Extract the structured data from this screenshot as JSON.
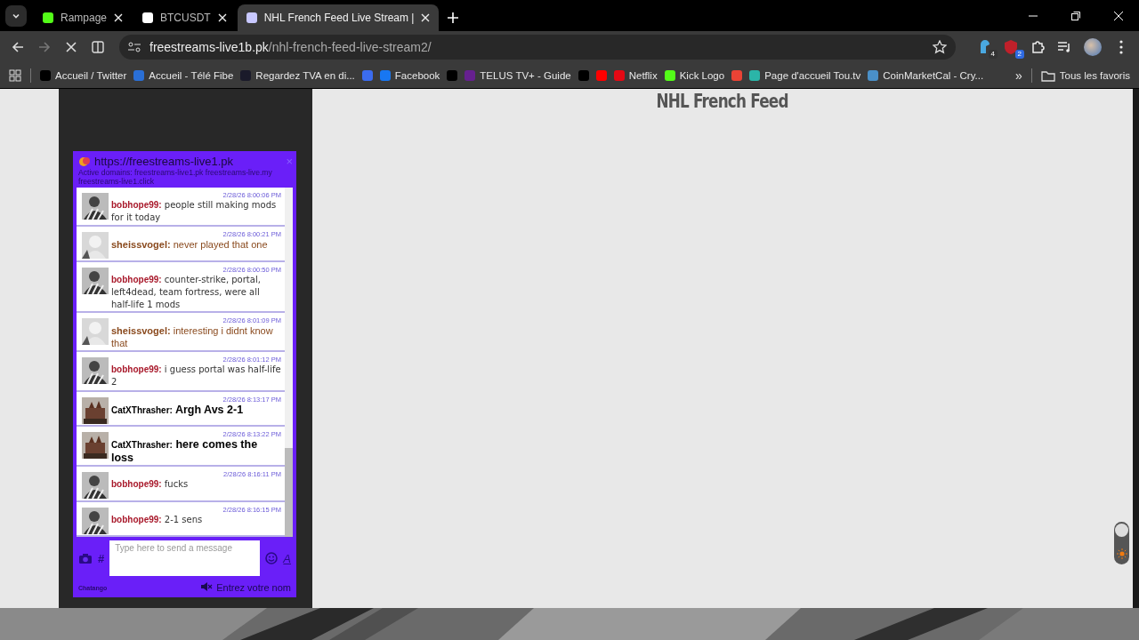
{
  "tabs": [
    {
      "title": "Rampage",
      "selected": false,
      "color": "#53fc18"
    },
    {
      "title": "BTCUSDT",
      "selected": false,
      "color": "#ffffff"
    },
    {
      "title": "NHL French Feed Live Stream |",
      "selected": true,
      "color": "#c8c8ff"
    }
  ],
  "address_bar": {
    "domain": "freestreams-live1b.pk",
    "path": "/nhl-french-feed-live-stream2/"
  },
  "extension_badges": [
    "4",
    "2"
  ],
  "bookmarks": [
    {
      "label": "Accueil / Twitter",
      "color": "#000000"
    },
    {
      "label": "Accueil - Télé Fibe",
      "color": "#2a6fd6"
    },
    {
      "label": "Regardez TVA en di...",
      "color": "#1a1a2a"
    },
    {
      "color": "#3b6cf0"
    },
    {
      "label": "Facebook",
      "color": "#1877f2"
    },
    {
      "color": "#000000"
    },
    {
      "label": "TELUS TV+ - Guide",
      "color": "#66208f"
    },
    {
      "color": "#000000"
    },
    {
      "color": "#ff0000"
    },
    {
      "label": "Netflix",
      "color": "#e50914"
    },
    {
      "label": "Kick Logo",
      "color": "#53fc18"
    },
    {
      "color": "#ea4335"
    },
    {
      "label": "Page d'accueil Tou.tv",
      "color": "#2bb5a8"
    },
    {
      "label": "CoinMarketCal - Cry...",
      "color": "#4a90c8"
    }
  ],
  "bookmarks_more": "»",
  "all_bookmarks": "Tous les favoris",
  "page_title": "NHL French Feed",
  "chat": {
    "url": "https://freestreams-live1.pk",
    "close": "×",
    "domains": "Active domains: freestreams-live1.pk freestreams-live.my freestreams-live1.click",
    "messages": [
      {
        "user": "bobhope99:",
        "color": "#a8182a",
        "kind": "comic",
        "time": "2/28/26 8:00:06 PM",
        "text": "people still making mods for it today"
      },
      {
        "user": "sheissvogel:",
        "color": "#8a4a1e",
        "kind": "tinted",
        "time": "2/28/26 8:00:21 PM",
        "text": "never played that one"
      },
      {
        "user": "bobhope99:",
        "color": "#a8182a",
        "kind": "comic",
        "time": "2/28/26 8:00:50 PM",
        "text": "counter-strike, portal, left4dead, team fortress, were all half-life 1 mods"
      },
      {
        "user": "sheissvogel:",
        "color": "#8a4a1e",
        "kind": "tinted",
        "time": "2/28/26 8:01:09 PM",
        "text": "interesting i didnt know that"
      },
      {
        "user": "bobhope99:",
        "color": "#a8182a",
        "kind": "comic",
        "time": "2/28/26 8:01:12 PM",
        "text": "i guess portal was half-life 2"
      },
      {
        "user": "CatXThrasher:",
        "color": "#000000",
        "kind": "big",
        "time": "2/28/26 8:13:17 PM",
        "text": "Argh Avs 2-1"
      },
      {
        "user": "CatXThrasher:",
        "color": "#000000",
        "kind": "big",
        "time": "2/28/26 8:13:22 PM",
        "text": "here comes the loss"
      },
      {
        "user": "bobhope99:",
        "color": "#a8182a",
        "kind": "comic",
        "time": "2/28/26 8:16:11 PM",
        "text": "fucks"
      },
      {
        "user": "bobhope99:",
        "color": "#a8182a",
        "kind": "comic",
        "time": "2/28/26 8:16:15 PM",
        "text": "2-1 sens"
      }
    ],
    "hash_button": "#",
    "input_placeholder": "Type here to send a message",
    "format_button": "A",
    "brand": "Chatango",
    "name_prompt": "Entrez votre nom"
  }
}
